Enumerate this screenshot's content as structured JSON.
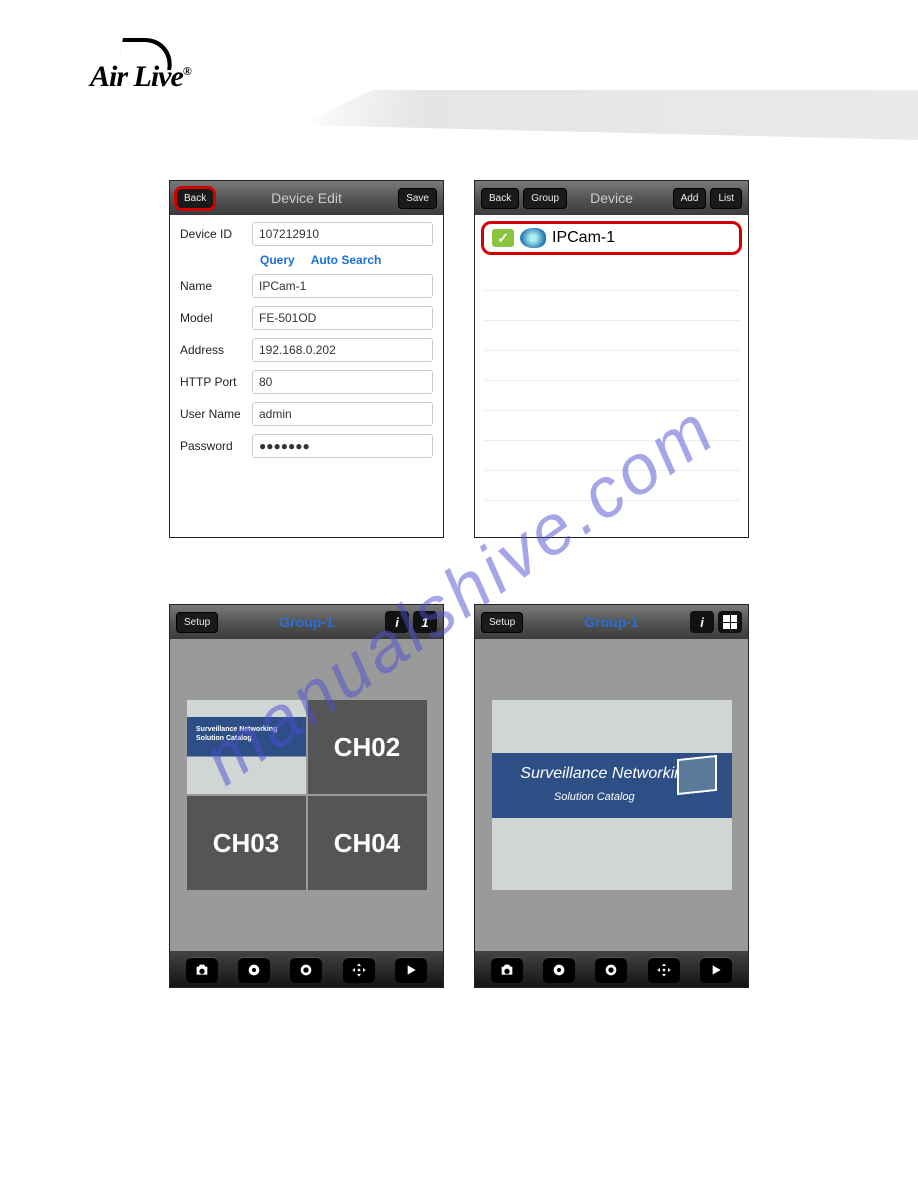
{
  "brand": "Air Live",
  "watermark": "manualshive.com",
  "screens": {
    "edit": {
      "back": "Back",
      "title": "Device Edit",
      "save": "Save",
      "fields": {
        "device_id_label": "Device ID",
        "device_id_value": "107212910",
        "query": "Query",
        "autosearch": "Auto Search",
        "name_label": "Name",
        "name_value": "IPCam-1",
        "model_label": "Model",
        "model_value": "FE-501OD",
        "address_label": "Address",
        "address_value": "192.168.0.202",
        "port_label": "HTTP Port",
        "port_value": "80",
        "user_label": "User Name",
        "user_value": "admin",
        "pass_label": "Password",
        "pass_value": "●●●●●●●"
      }
    },
    "list": {
      "back": "Back",
      "group": "Group",
      "title": "Device",
      "add": "Add",
      "list_btn": "List",
      "item": "IPCam-1"
    },
    "viewer": {
      "setup": "Setup",
      "title": "Group-1",
      "ch02": "CH02",
      "ch03": "CH03",
      "ch04": "CH04",
      "banner1": "Surveillance Networking",
      "banner2": "Solution Catalog"
    }
  }
}
